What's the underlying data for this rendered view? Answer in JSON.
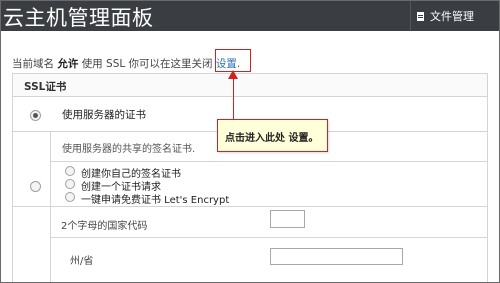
{
  "header": {
    "title": "云主机管理面板",
    "file_manager_label": "文件管理",
    "file_icon": "document-icon"
  },
  "notice": {
    "prefix": "当前域名",
    "allow": "允许",
    "middle": "使用 SSL 你可以在这里关闭",
    "link": "设置",
    "suffix": "."
  },
  "ssl": {
    "section_title": "SSL证书",
    "use_server_cert_label": "使用服务器的证书",
    "use_server_cert_desc": "使用服务器的共享的签名证书.",
    "options": [
      "创建你自己的签名证书",
      "创建一个证书请求",
      "一键申请免费证书 Let's Encrypt"
    ],
    "country_code_label": "2个字母的国家代码",
    "country_code_value": "",
    "province_label": "州/省",
    "province_value": ""
  },
  "callout": {
    "text": "点击进入此处 设置。"
  },
  "colors": {
    "topbar": "#3a3d42",
    "link": "#2a6fb5",
    "annotation": "#d32020",
    "callout_bg": "#ffffd9"
  }
}
